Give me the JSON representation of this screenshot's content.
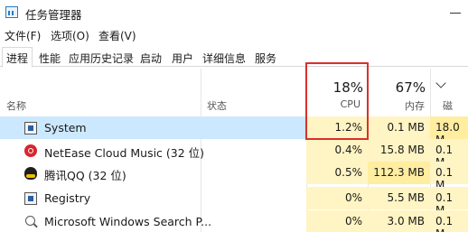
{
  "window": {
    "title": "任务管理器",
    "icon": "task-manager-icon"
  },
  "menu": [
    {
      "label": "文件(F)"
    },
    {
      "label": "选项(O)"
    },
    {
      "label": "查看(V)"
    }
  ],
  "tabs": [
    {
      "label": "进程",
      "active": true
    },
    {
      "label": "性能"
    },
    {
      "label": "应用历史记录"
    },
    {
      "label": "启动"
    },
    {
      "label": "用户"
    },
    {
      "label": "详细信息"
    },
    {
      "label": "服务"
    }
  ],
  "columns": {
    "name": "名称",
    "status": "状态",
    "cpu": {
      "percent": "18%",
      "label": "CPU"
    },
    "memory": {
      "percent": "67%",
      "label": "内存"
    },
    "disk": {
      "percent": "",
      "label": "磁"
    }
  },
  "processes": [
    {
      "name": "System",
      "icon": "system-icon",
      "cpu": "1.2%",
      "memory": "0.1 MB",
      "disk": "18.0 M",
      "selected": true
    },
    {
      "name": "NetEase Cloud Music (32 位)",
      "icon": "netease-cloud-music-icon",
      "cpu": "0.4%",
      "memory": "15.8 MB",
      "disk": "0.1 M"
    },
    {
      "name": "腾讯QQ (32 位)",
      "icon": "qq-icon",
      "cpu": "0.5%",
      "memory": "112.3 MB",
      "disk": "0.1 M"
    },
    {
      "name": "Registry",
      "icon": "registry-icon",
      "cpu": "0%",
      "memory": "5.5 MB",
      "disk": "0.1 M"
    },
    {
      "name": "Microsoft Windows Search P...",
      "icon": "search-icon",
      "cpu": "0%",
      "memory": "3.0 MB",
      "disk": "0.1 M"
    }
  ],
  "colors": {
    "selection": "#cce8ff",
    "heat_light": "#fff4c4",
    "heat_medium": "#ffeda0",
    "highlight_border": "#d9302c"
  }
}
